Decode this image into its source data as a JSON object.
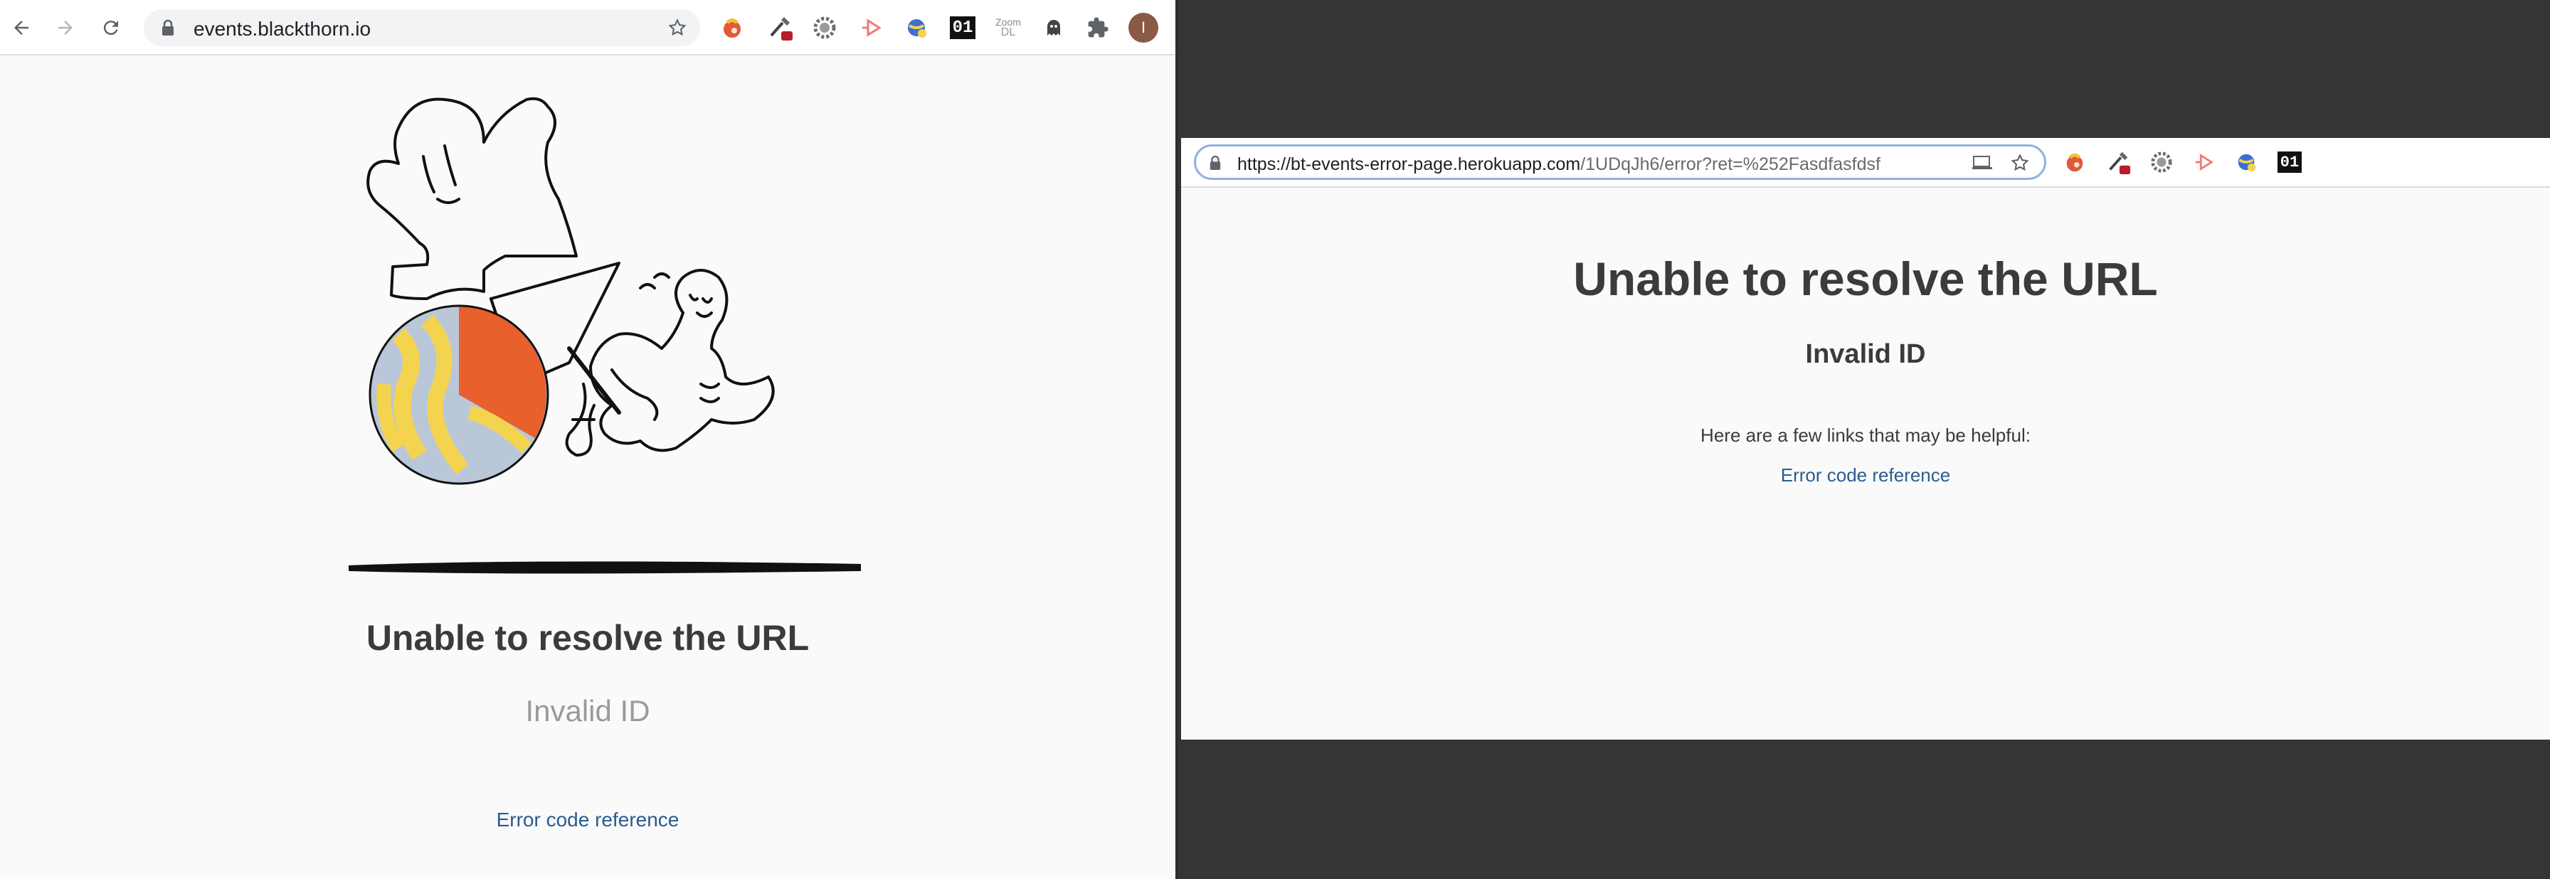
{
  "left_window": {
    "address_bar": {
      "url": "events.blackthorn.io"
    },
    "toolbar": {
      "back_icon": "arrow-left-icon",
      "forward_icon": "arrow-right-icon",
      "reload_icon": "reload-icon",
      "extensions": [
        "tomato-ext-icon",
        "eyedropper-ext-icon",
        "gear-ext-icon",
        "play-ext-icon",
        "globe-ext-icon",
        "01-ext-icon",
        "zoom-dl-ext-icon",
        "ghost-ext-icon",
        "puzzle-icon"
      ],
      "ext_01_label": "01",
      "zoom_dl_label_top": "Zoom",
      "zoom_dl_label_bottom": "DL",
      "profile_initial": "I"
    },
    "page": {
      "title": "Unable to resolve the URL",
      "subtitle": "Invalid ID",
      "link": "Error code reference"
    }
  },
  "right_window": {
    "address_bar": {
      "url_host": "https://bt-events-error-page.herokuapp.com",
      "url_path": "/1UDqJh6/error?ret=%252Fasdfasfdsf"
    },
    "toolbar": {
      "extensions": [
        "tomato-ext-icon",
        "eyedropper-ext-icon",
        "gear-ext-icon",
        "play-ext-icon",
        "globe-ext-icon",
        "01-ext-icon"
      ],
      "ext_01_label": "01"
    },
    "page": {
      "title": "Unable to resolve the URL",
      "subtitle": "Invalid ID",
      "help_text": "Here are a few links that may be helpful:",
      "link": "Error code reference"
    }
  },
  "colors": {
    "page_bg": "#fafafa",
    "desktop_bg": "#353535",
    "heading": "#3b3b3b",
    "link": "#2a5c8f",
    "ball_orange": "#e8602c",
    "ball_yellow": "#f4d44f",
    "ball_blue": "#b9c7d9"
  }
}
